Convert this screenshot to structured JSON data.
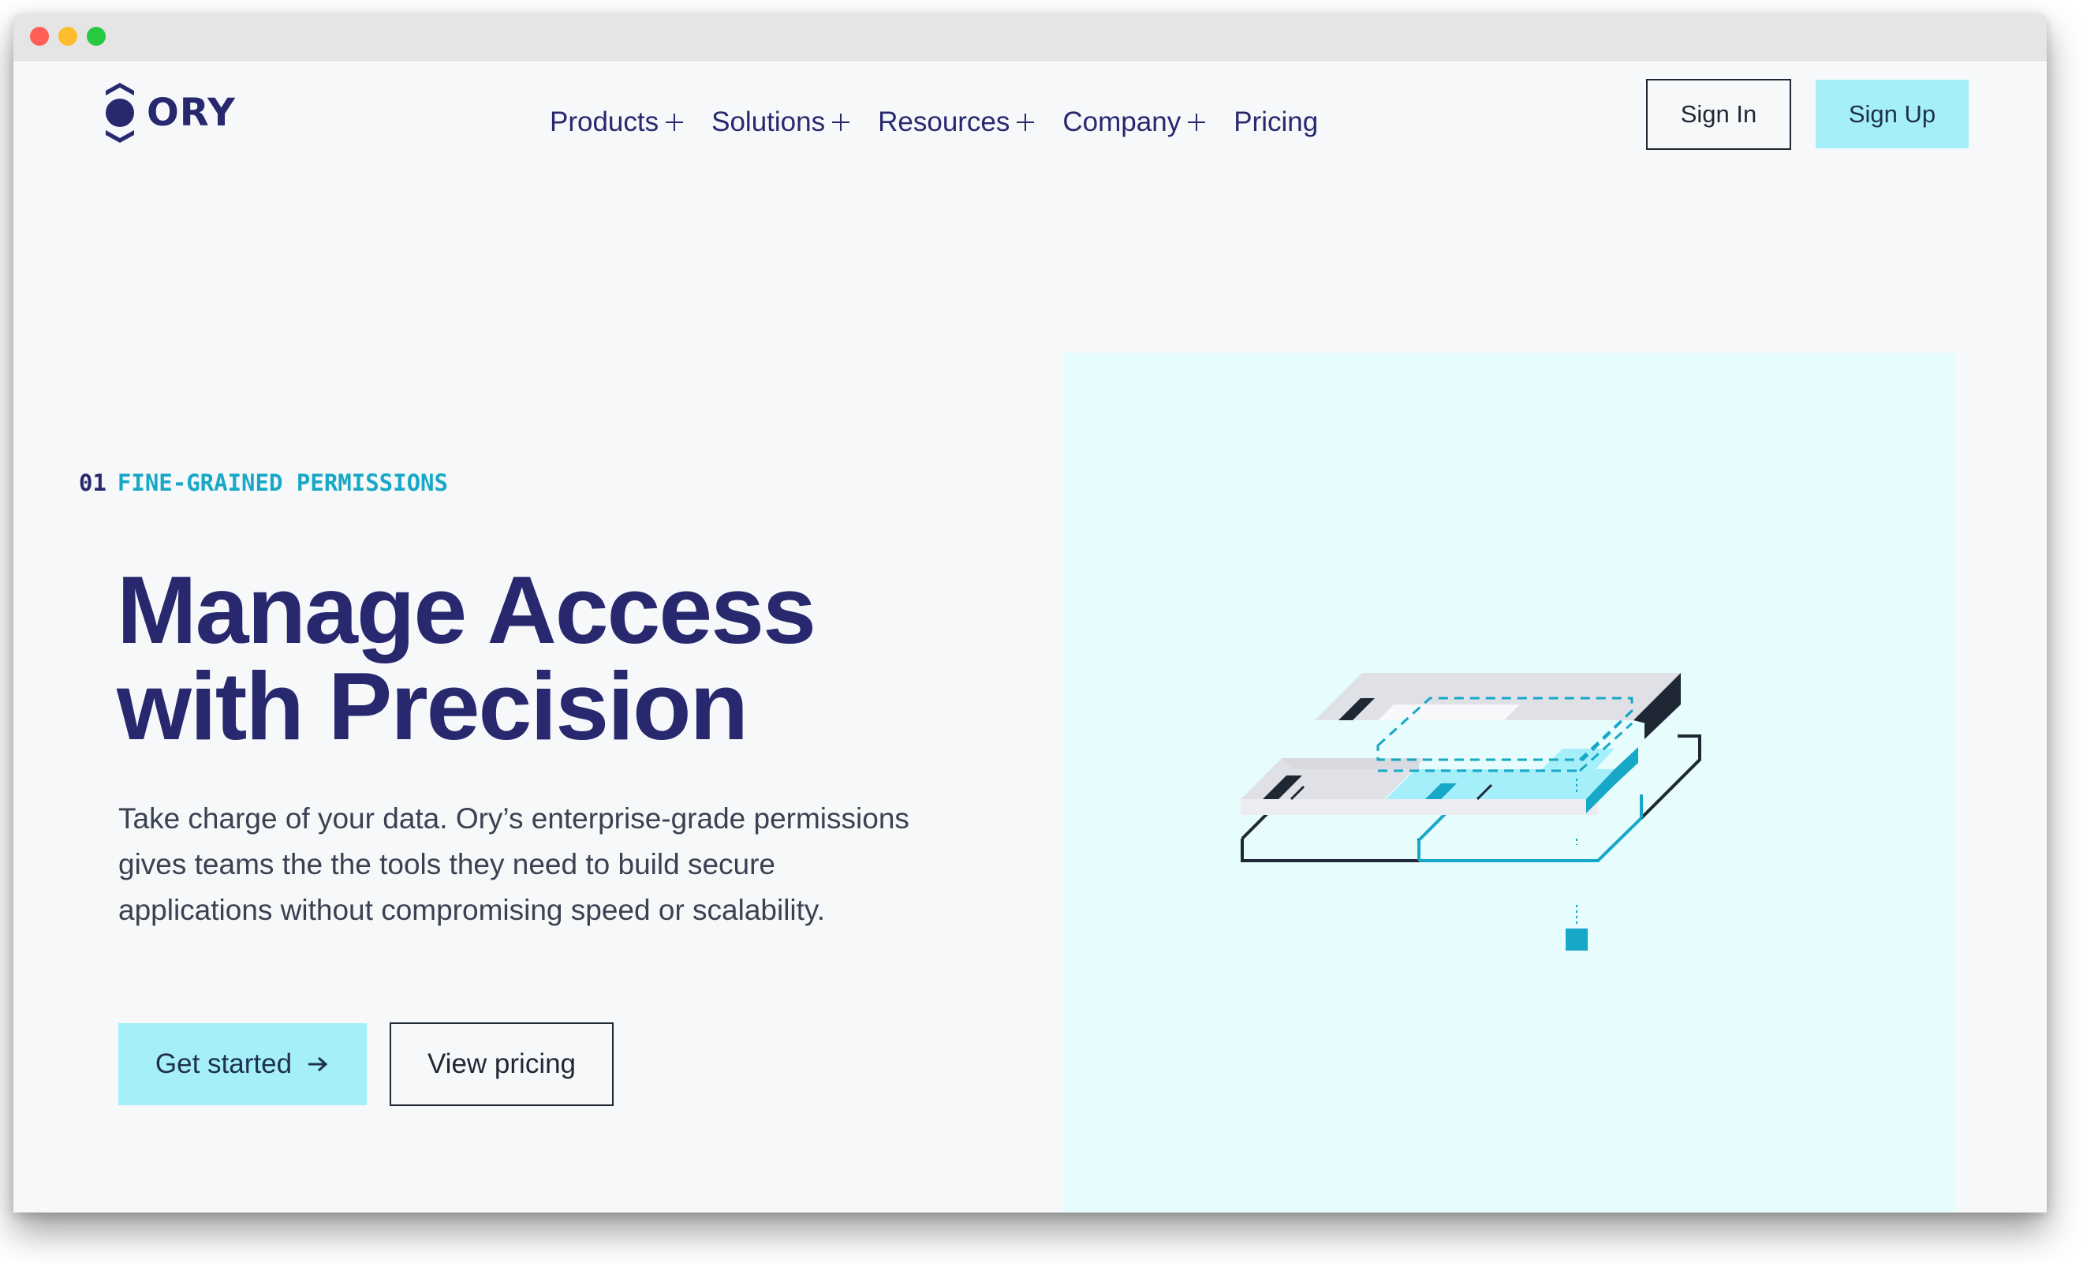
{
  "window": {
    "controls": [
      "close",
      "minimize",
      "maximize"
    ]
  },
  "brand": {
    "name": "ORY",
    "logo_icon": "ory-hexagon-logo-icon",
    "color": "#28286e"
  },
  "nav": {
    "items": [
      {
        "label": "Products",
        "icon": "plus-icon"
      },
      {
        "label": "Solutions",
        "icon": "plus-icon"
      },
      {
        "label": "Resources",
        "icon": "plus-icon"
      },
      {
        "label": "Company",
        "icon": "plus-icon"
      },
      {
        "label": "Pricing"
      }
    ]
  },
  "auth": {
    "sign_in": "Sign In",
    "sign_up": "Sign Up"
  },
  "hero": {
    "eyebrow_number": "01",
    "eyebrow_label": "FINE-GRAINED PERMISSIONS",
    "headline_line1": "Manage Access",
    "headline_line2": "with Precision",
    "body_line1": "Take charge of your data. Ory’s enterprise-grade permissions",
    "body_line2": "gives teams the the tools they need to build secure",
    "body_line3": "applications without compromising speed or scalability.",
    "primary_cta": "Get started",
    "primary_cta_icon": "arrow-right-icon",
    "secondary_cta": "View pricing"
  },
  "colors": {
    "accent_cyan": "#a4eff9",
    "accent_teal": "#18a8c6",
    "panel_bg": "#e6fcfd",
    "text_dark": "#1f2735",
    "page_bg": "#f6f8fa"
  },
  "illustration": {
    "icon": "isometric-permissions-blocks-illustration"
  }
}
